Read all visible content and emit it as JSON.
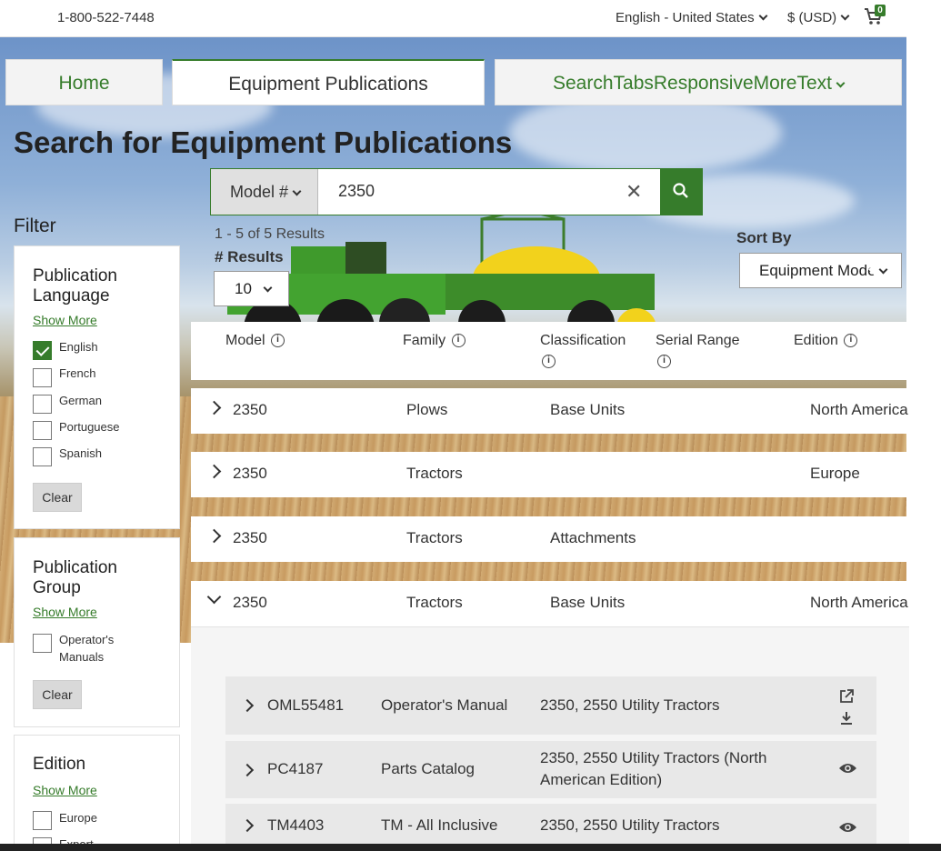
{
  "topbar": {
    "phone": "1-800-522-7448",
    "language": "English - United States",
    "currency": "$ (USD)",
    "cart_count": "0"
  },
  "tabs": [
    {
      "label": "Home"
    },
    {
      "label": "Equipment Publications"
    },
    {
      "label": "SearchTabsResponsiveMoreText"
    }
  ],
  "page_title": "Search for Equipment Publications",
  "search": {
    "type_label": "Model #",
    "value": "2350"
  },
  "results": {
    "count_text": "1 - 5 of 5 Results",
    "per_page_label": "# Results",
    "per_page_value": "10",
    "sort_label": "Sort By",
    "sort_value": "Equipment Model"
  },
  "filter": {
    "title": "Filter",
    "show_more": "Show More",
    "clear": "Clear",
    "language": {
      "title": "Publication Language",
      "options": [
        {
          "label": "English",
          "checked": true
        },
        {
          "label": "French",
          "checked": false
        },
        {
          "label": "German",
          "checked": false
        },
        {
          "label": "Portuguese",
          "checked": false
        },
        {
          "label": "Spanish",
          "checked": false
        }
      ]
    },
    "group": {
      "title": "Publication Group",
      "options": [
        {
          "label": "Operator's Manuals",
          "checked": false
        }
      ]
    },
    "edition": {
      "title": "Edition",
      "options": [
        {
          "label": "Europe",
          "checked": false
        },
        {
          "label": "Export",
          "checked": false
        }
      ]
    }
  },
  "table": {
    "headers": [
      "Model",
      "Family",
      "Classification",
      "Serial Range",
      "Edition"
    ],
    "rows": [
      {
        "model": "2350",
        "family": "Plows",
        "classification": "Base Units",
        "edition": "North America"
      },
      {
        "model": "2350",
        "family": "Tractors",
        "classification": "",
        "edition": "Europe"
      },
      {
        "model": "2350",
        "family": "Tractors",
        "classification": "Attachments",
        "edition": ""
      },
      {
        "model": "2350",
        "family": "Tractors",
        "classification": "Base Units",
        "edition": "North America"
      }
    ],
    "publications": [
      {
        "number": "OML55481",
        "type": "Operator's Manual",
        "title": "2350, 2550 Utility Tractors",
        "actions": [
          "external-link-icon",
          "download-icon"
        ]
      },
      {
        "number": "PC4187",
        "type": "Parts Catalog",
        "title": "2350, 2550 Utility Tractors (North American Edition)",
        "actions": [
          "view-icon"
        ]
      },
      {
        "number": "TM4403",
        "type": "TM - All Inclusive",
        "title": "2350, 2550 Utility Tractors",
        "actions": [
          "view-icon"
        ]
      }
    ]
  },
  "colors": {
    "brand_green": "#367c2b",
    "yellow": "#ffde00"
  }
}
